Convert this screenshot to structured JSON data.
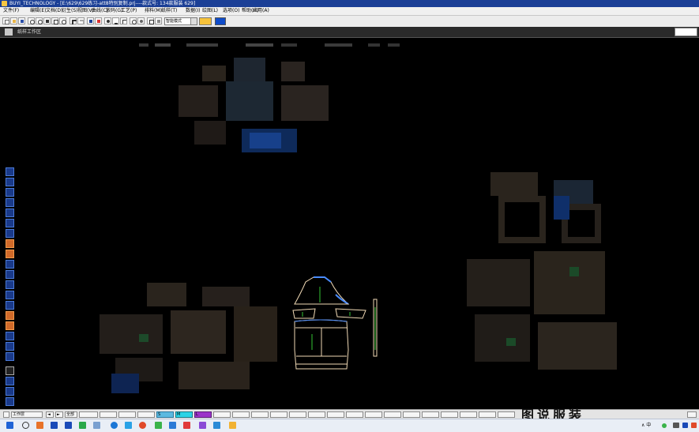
{
  "window": {
    "title": "BUYI_TECHNOLOGY - [E:\\629\\629练习-att8特别复制.prj----款式号: 134款服装 629]"
  },
  "menu": {
    "items": [
      "文件(F)",
      "编辑(E)",
      "文档(D)",
      "衍生(S)",
      "视图(V)",
      "曲线(C)",
      "放码(G)",
      "工艺(P)",
      "排料(M)",
      "纸样(T)",
      "数据(I)",
      "绘图(L)",
      "选项(O)",
      "帮助(H)",
      "应用(A)"
    ]
  },
  "toolbar": {
    "mode_select_value": "智能模式",
    "accent_swatch_color": "#f6c23a",
    "blue_swatch_color": "#0f4cc9"
  },
  "panel": {
    "label": "纸样工作区"
  },
  "status": {
    "layer_label": "工作层",
    "arrow_prev": "◄",
    "arrow_next": "►",
    "all_label": "全部",
    "field_s": "S",
    "field_m": "M",
    "field_l": "L"
  },
  "taskbar": {
    "tray_text": "∧ 中"
  },
  "colors": {
    "titlebar": "#1b3f96",
    "pattern_outline": "#f0d9b5",
    "pattern_highlight": "#4a8cff",
    "grain_line": "#35c435"
  },
  "watermark": "图说服装"
}
